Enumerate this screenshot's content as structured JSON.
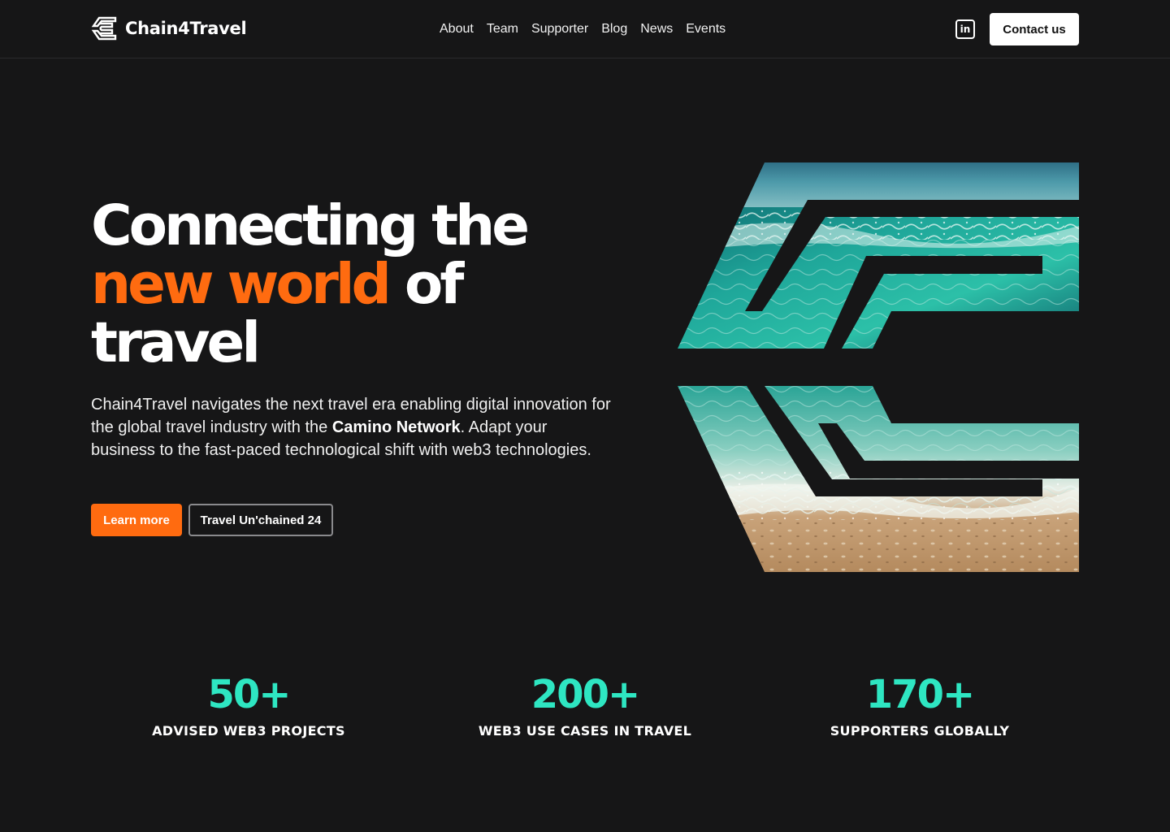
{
  "brand": {
    "name": "Chain4Travel",
    "logo_icon": "chain4travel-logo-icon"
  },
  "nav": {
    "items": [
      "About",
      "Team",
      "Supporter",
      "Blog",
      "News",
      "Events"
    ]
  },
  "header": {
    "linkedin_label": "in",
    "contact_label": "Contact us"
  },
  "hero": {
    "title_line1": "Connecting the",
    "title_accent": "new world",
    "title_line2_rest": " of",
    "title_line3": "travel",
    "desc_part1": "Chain4Travel navigates the next travel era enabling digital innovation for the global travel industry with the ",
    "desc_strong": "Camino Network",
    "desc_part2": ". Adapt your business to the fast-paced technological shift with web3 technologies.",
    "primary_button": "Learn more",
    "secondary_button": "Travel Un'chained 24"
  },
  "stats": [
    {
      "value": "50+",
      "label": "ADVISED WEB3 PROJECTS"
    },
    {
      "value": "200+",
      "label": "WEB3 USE CASES IN TRAVEL"
    },
    {
      "value": "170+",
      "label": "SUPPORTERS GLOBALLY"
    }
  ],
  "colors": {
    "background": "#161617",
    "accent": "#ff6b10",
    "stat": "#2ee6c2"
  }
}
